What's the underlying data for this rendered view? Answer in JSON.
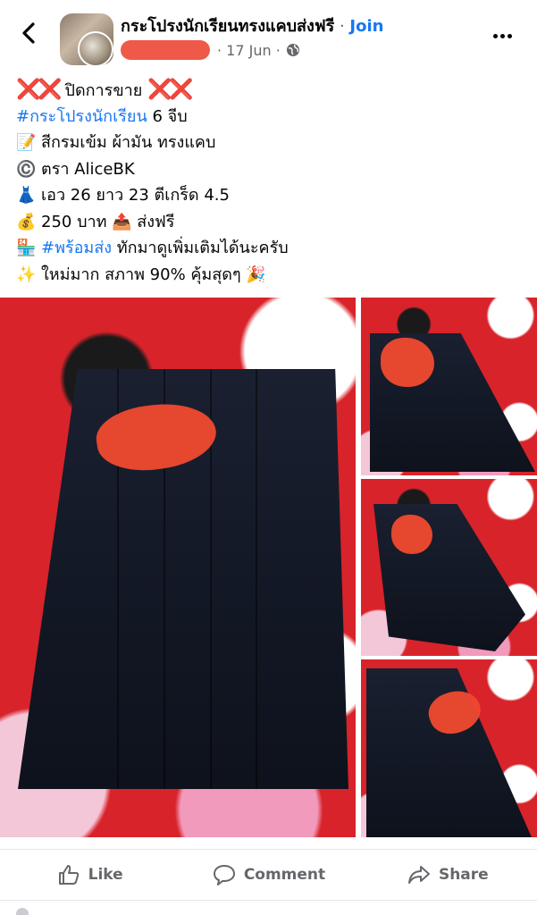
{
  "header": {
    "group_name": "กระโปรงนักเรียนทรงแคบส่งฟรี",
    "separator": " · ",
    "join_label": "Join",
    "date": "· 17 Jun ·",
    "back_icon": "chevron-left-icon",
    "more_icon": "more-dots-icon",
    "privacy_icon": "globe-icon"
  },
  "post": {
    "line1": {
      "prefix": "❌❌",
      "text": "ปิดการขาย",
      "suffix": "❌❌"
    },
    "line2": {
      "hashtag": "#กระโปรงนักเรียน",
      "text": " 6 จีบ"
    },
    "line3": {
      "emoji": "📝",
      "text": "สีกรมเข้ม ผ้ามัน ทรงแคบ"
    },
    "line4": {
      "emoji": "©️",
      "text": "ตรา AliceBK"
    },
    "line5": {
      "emoji": "👗",
      "text": "เอว 26 ยาว 23 ตีเกร็ด 4.5"
    },
    "line6": {
      "emoji": "💰",
      "text": "250 บาท",
      "emoji2": "📤",
      "text2": "ส่งฟรี"
    },
    "line7": {
      "emoji": "🏪",
      "hashtag": "#พร้อมส่ง",
      "text": " ทักมาดูเพิ่มเติมได้นะครับ"
    },
    "line8": {
      "emoji": "✨",
      "text": "ใหม่มาก สภาพ 90% คุ้มสุดๆ",
      "emoji2": "🎉"
    }
  },
  "photos": {
    "count_shown": 4
  },
  "actions": {
    "like_label": "Like",
    "comment_label": "Comment",
    "share_label": "Share"
  },
  "colors": {
    "accent": "#1877f2",
    "muted_text": "#65676b",
    "redaction": "#f04a2f",
    "cloth_background": "#d8232a",
    "skirt_navy": "#141a28"
  }
}
